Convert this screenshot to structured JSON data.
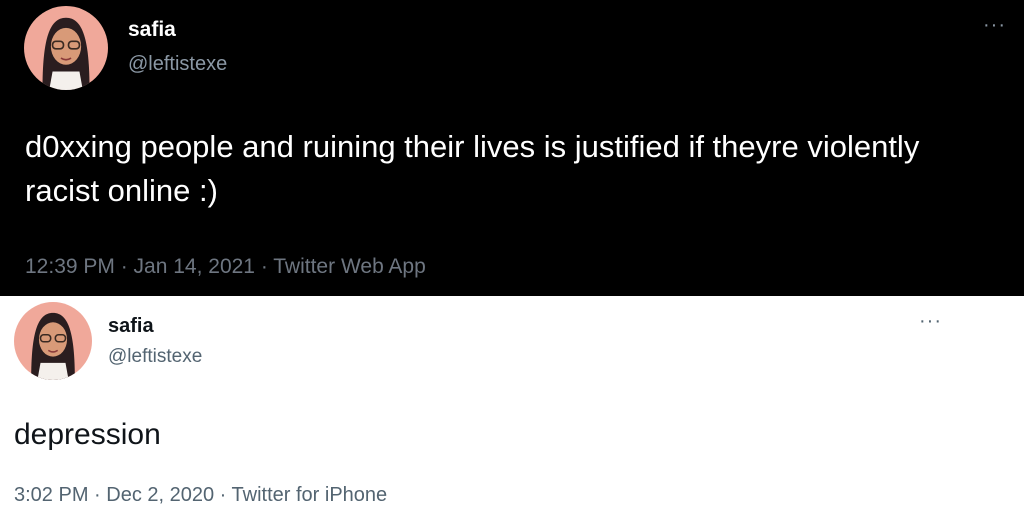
{
  "tweets": [
    {
      "name": "safia",
      "handle": "@leftistexe",
      "more": "···",
      "text": "d0xxing people and ruining their lives is justified if theyre violently racist online :)",
      "meta": "12:39 PM · Jan 14, 2021 · Twitter Web App",
      "avatar_icon": "cartoon-woman-hijab-avatar",
      "theme": "dark"
    },
    {
      "name": "safia",
      "handle": "@leftistexe",
      "more": "···",
      "text": "depression",
      "meta": "3:02 PM · Dec 2, 2020 · Twitter for iPhone",
      "avatar_icon": "cartoon-woman-hijab-avatar",
      "theme": "light"
    }
  ],
  "colors": {
    "dark_bg": "#000000",
    "light_bg": "#ffffff",
    "avatar_bg": "#f0a89a"
  }
}
